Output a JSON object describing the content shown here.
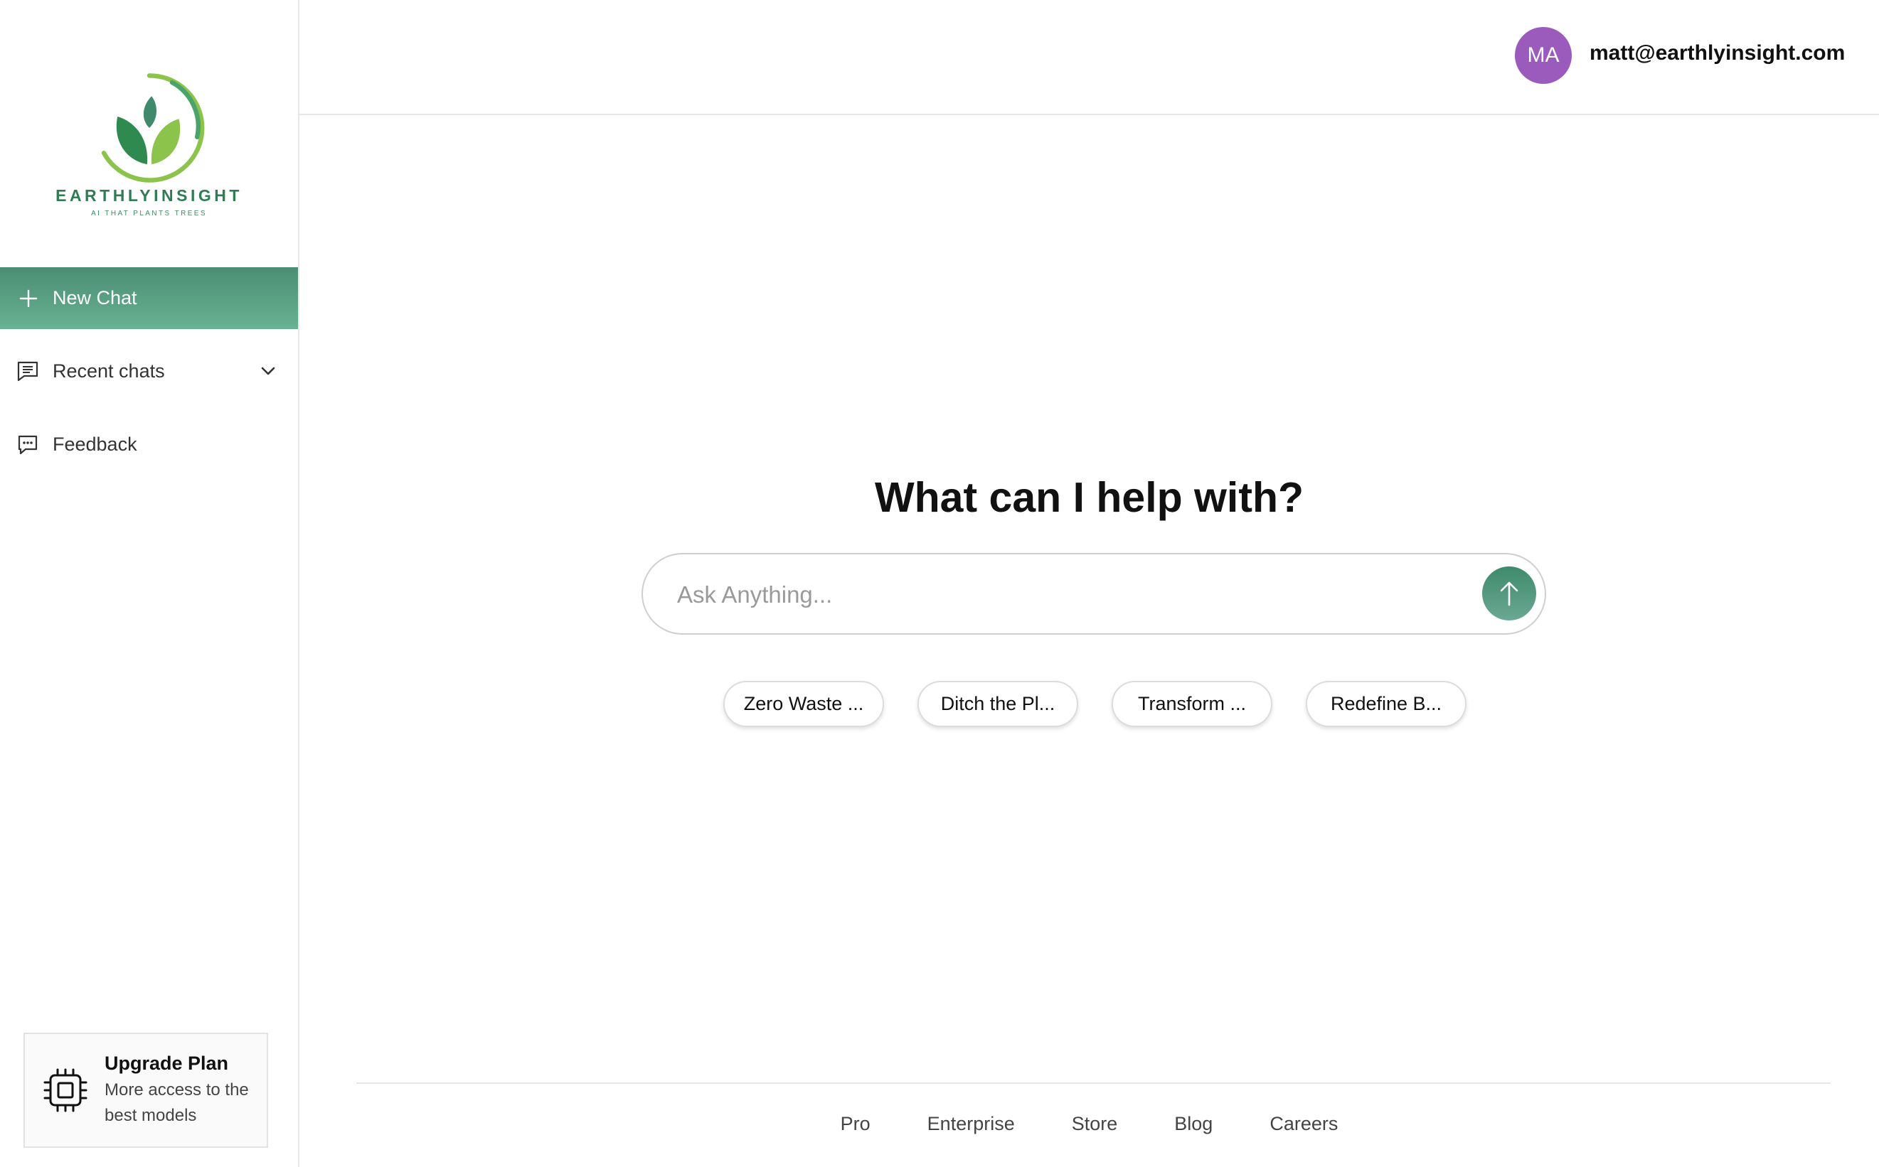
{
  "brand": {
    "name": "EARTHLYINSIGHT",
    "tagline": "AI THAT PLANTS TREES",
    "primary_color": "#5a9e80",
    "logo_icon": "leaf-logo"
  },
  "sidebar": {
    "new_chat": {
      "label": "New Chat",
      "icon": "plus-icon"
    },
    "items": [
      {
        "label": "Recent chats",
        "icon": "chat-lines-icon",
        "trailing_icon": "chevron-down-icon"
      },
      {
        "label": "Feedback",
        "icon": "chat-bubble-dots-icon"
      }
    ],
    "upgrade": {
      "title": "Upgrade Plan",
      "subtitle": "More access to the best models",
      "icon": "chip-icon"
    }
  },
  "header": {
    "avatar_initials": "MA",
    "avatar_color": "#9b5bbd",
    "email": "matt@earthlyinsight.com"
  },
  "main": {
    "heading": "What can I help with?",
    "search": {
      "placeholder": "Ask Anything...",
      "value": ""
    },
    "send_icon": "arrow-up-icon",
    "suggestions": [
      "Zero Waste ...",
      "Ditch the Pl...",
      "Transform ...",
      "Redefine B..."
    ]
  },
  "footer": {
    "links": [
      "Pro",
      "Enterprise",
      "Store",
      "Blog",
      "Careers"
    ]
  }
}
